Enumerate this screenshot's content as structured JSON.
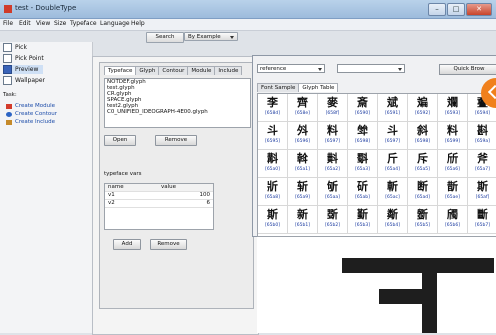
{
  "window": {
    "title": "test - DoubleType"
  },
  "menu": [
    "File",
    "Edit",
    "View",
    "Size",
    "Typeface",
    "Language",
    "Help"
  ],
  "toolbar": {
    "search_label": "Search",
    "by_example_label": "By Example"
  },
  "sidebar": {
    "items": [
      {
        "label": "Pick"
      },
      {
        "label": "Pick Point"
      },
      {
        "label": "Preview"
      },
      {
        "label": "Wallpaper"
      }
    ],
    "tasks_label": "Task:",
    "tasks": [
      {
        "label": "Create Module"
      },
      {
        "label": "Create Contour"
      },
      {
        "label": "Create Include"
      }
    ]
  },
  "panel": {
    "tabs": [
      "Typeface",
      "Glyph",
      "Contour",
      "Module",
      "Include"
    ],
    "active_tab": "Typeface",
    "files": [
      "NOTDEF.glyph",
      "test.glyph",
      "CR.glyph",
      "SPACE.glyph",
      "test2.glyph",
      "C0_UNIFIED_IDEOGRAPH-4E00.glyph"
    ],
    "open_label": "Open",
    "remove_label": "Remove",
    "vars_label": "typeface vars",
    "vars_columns": [
      "name",
      "value"
    ],
    "vars": [
      {
        "name": "v1",
        "value": "100"
      },
      {
        "name": "v2",
        "value": "6"
      }
    ],
    "add_label": "Add",
    "remove2_label": "Remove"
  },
  "reference": {
    "dropdown_value": "reference",
    "dropdown2_value": "",
    "quick_label": "Quick Brow",
    "tabs": [
      "Font Sample",
      "Glyph Table"
    ],
    "active_tab": "Glyph Table",
    "rows": [
      [
        {
          "g": "李",
          "c": "[658d]"
        },
        {
          "g": "齊",
          "c": "[658e]"
        },
        {
          "g": "麥",
          "c": "[658f]"
        },
        {
          "g": "斎",
          "c": "[6590]"
        },
        {
          "g": "斌",
          "c": "[6591]"
        },
        {
          "g": "斒",
          "c": "[6592]"
        },
        {
          "g": "斕",
          "c": "[6593]"
        },
        {
          "g": "斖",
          "c": "[6594]"
        }
      ],
      [
        {
          "g": "斗",
          "c": "[6595]"
        },
        {
          "g": "斘",
          "c": "[6596]"
        },
        {
          "g": "料",
          "c": "[6597]"
        },
        {
          "g": "斚",
          "c": "[6598]"
        },
        {
          "g": "斗",
          "c": "[6597]"
        },
        {
          "g": "斜",
          "c": "[6598]"
        },
        {
          "g": "料",
          "c": "[6599]"
        },
        {
          "g": "斟",
          "c": "[659a]"
        }
      ],
      [
        {
          "g": "斠",
          "c": "[65a0]"
        },
        {
          "g": "斡",
          "c": "[65a1]"
        },
        {
          "g": "斢",
          "c": "[65a2]"
        },
        {
          "g": "斣",
          "c": "[65a3]"
        },
        {
          "g": "斤",
          "c": "[65a4]"
        },
        {
          "g": "斥",
          "c": "[65a5]"
        },
        {
          "g": "斦",
          "c": "[65a6]"
        },
        {
          "g": "斧",
          "c": "[65a7]"
        }
      ],
      [
        {
          "g": "斨",
          "c": "[65a8]"
        },
        {
          "g": "斩",
          "c": "[65a9]"
        },
        {
          "g": "斪",
          "c": "[65aa]"
        },
        {
          "g": "斫",
          "c": "[65ab]"
        },
        {
          "g": "斬",
          "c": "[65ac]"
        },
        {
          "g": "断",
          "c": "[65ad]"
        },
        {
          "g": "斮",
          "c": "[65ae]"
        },
        {
          "g": "斯",
          "c": "[65af]"
        }
      ],
      [
        {
          "g": "斯",
          "c": "[65b0]"
        },
        {
          "g": "新",
          "c": "[65b1]"
        },
        {
          "g": "斲",
          "c": "[65b2]"
        },
        {
          "g": "斳",
          "c": "[65b3]"
        },
        {
          "g": "斴",
          "c": "[65b4]"
        },
        {
          "g": "斵",
          "c": "[65b5]"
        },
        {
          "g": "斶",
          "c": "[65b6]"
        },
        {
          "g": "斷",
          "c": "[65b7]"
        }
      ]
    ]
  }
}
